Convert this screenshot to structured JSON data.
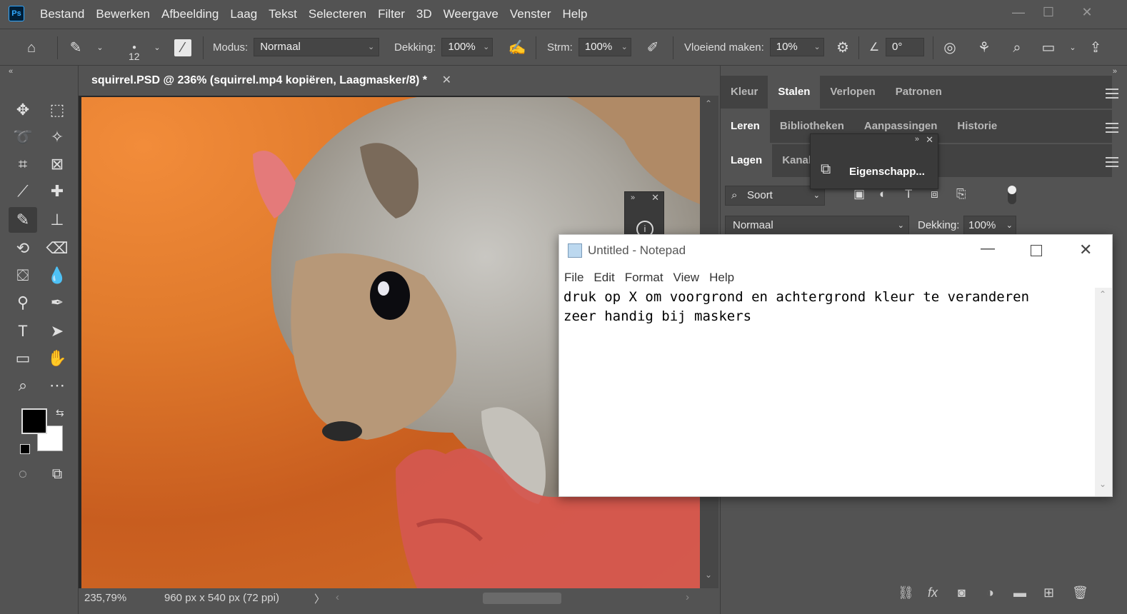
{
  "app": {
    "logo": "Ps"
  },
  "menu": [
    "Bestand",
    "Bewerken",
    "Afbeelding",
    "Laag",
    "Tekst",
    "Selecteren",
    "Filter",
    "3D",
    "Weergave",
    "Venster",
    "Help"
  ],
  "options": {
    "brush_size": "12",
    "mode_label": "Modus:",
    "mode_value": "Normaal",
    "opacity_label": "Dekking:",
    "opacity_value": "100%",
    "flow_label": "Strm:",
    "flow_value": "100%",
    "smoothing_label": "Vloeiend maken:",
    "smoothing_value": "10%",
    "angle_value": "0°"
  },
  "document": {
    "tab_title": "squirrel.PSD @ 236% (squirrel.mp4 kopiëren, Laagmasker/8) *",
    "zoom": "235,79%",
    "dimensions": "960 px x 540 px (72 ppi)"
  },
  "panels": {
    "row1_tabs": [
      "Kleur",
      "Stalen",
      "Verlopen",
      "Patronen"
    ],
    "row2_tabs": [
      "Leren",
      "Bibliotheken",
      "Aanpassingen",
      "Historie"
    ],
    "row3_tabs": [
      "Lagen",
      "Kanale"
    ],
    "filter_label": "Soort",
    "blend_mode": "Normaal",
    "layer_opacity_label": "Dekking:",
    "layer_opacity_value": "100%",
    "float_panel_label": "Eigenschapp..."
  },
  "notepad": {
    "title": "Untitled - Notepad",
    "menu": [
      "File",
      "Edit",
      "Format",
      "View",
      "Help"
    ],
    "text": "druk op X om voorgrond en achtergrond kleur te veranderen\nzeer handig bij maskers"
  }
}
